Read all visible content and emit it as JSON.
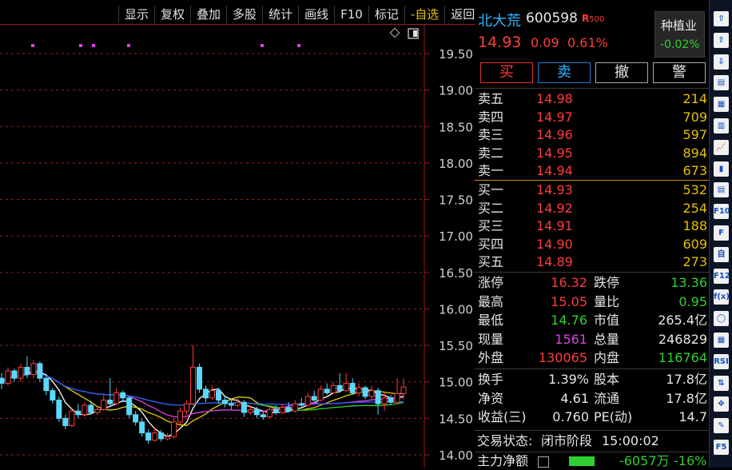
{
  "toolbar": {
    "items": [
      "显示",
      "复权",
      "叠加",
      "多股",
      "统计",
      "画线",
      "F10",
      "标记",
      "-自选",
      "返回"
    ]
  },
  "stock": {
    "name": "北大荒",
    "code": "600598",
    "badge": "R",
    "badge_num": "500",
    "price": "14.93",
    "change": "0.09",
    "change_pct": "0.61%",
    "sector": "种植业",
    "sector_pct": "-0.02%"
  },
  "buttons": {
    "buy": "买",
    "sell": "卖",
    "cancel": "撤",
    "alert": "警"
  },
  "asks": [
    {
      "label": "卖五",
      "price": "14.98",
      "vol": "214"
    },
    {
      "label": "卖四",
      "price": "14.97",
      "vol": "709"
    },
    {
      "label": "卖三",
      "price": "14.96",
      "vol": "597"
    },
    {
      "label": "卖二",
      "price": "14.95",
      "vol": "894"
    },
    {
      "label": "卖一",
      "price": "14.94",
      "vol": "673"
    }
  ],
  "bids": [
    {
      "label": "买一",
      "price": "14.93",
      "vol": "532"
    },
    {
      "label": "买二",
      "price": "14.92",
      "vol": "254"
    },
    {
      "label": "买三",
      "price": "14.91",
      "vol": "188"
    },
    {
      "label": "买四",
      "price": "14.90",
      "vol": "609"
    },
    {
      "label": "买五",
      "price": "14.89",
      "vol": "273"
    }
  ],
  "stats1": [
    {
      "l1": "涨停",
      "v1": "16.32",
      "c1": "#ff3c3c",
      "l2": "跌停",
      "v2": "13.36",
      "c2": "#2fd02f"
    },
    {
      "l1": "最高",
      "v1": "15.05",
      "c1": "#ff3c3c",
      "l2": "量比",
      "v2": "0.95",
      "c2": "#2fd02f"
    },
    {
      "l1": "最低",
      "v1": "14.76",
      "c1": "#2fd02f",
      "l2": "市值",
      "v2": "265.4亿",
      "c2": "#e6e6e6"
    },
    {
      "l1": "现量",
      "v1": "1561",
      "c1": "#e040e0",
      "l2": "总量",
      "v2": "246829",
      "c2": "#e6e6e6"
    },
    {
      "l1": "外盘",
      "v1": "130065",
      "c1": "#ff3c3c",
      "l2": "内盘",
      "v2": "116764",
      "c2": "#2fd02f"
    }
  ],
  "stats2": [
    {
      "l1": "换手",
      "v1": "1.39%",
      "l2": "股本",
      "v2": "17.8亿"
    },
    {
      "l1": "净资",
      "v1": "4.61",
      "l2": "流通",
      "v2": "17.8亿"
    },
    {
      "l1": "收益(三)",
      "v1": "0.760",
      "l2": "PE(动)",
      "v2": "14.7"
    }
  ],
  "trade_status": {
    "label": "交易状态:",
    "status": "闭市阶段",
    "time": "15:00:02"
  },
  "main_flow": {
    "label": "主力净额",
    "value": "-6057万",
    "pct": "-16%"
  },
  "colors": {
    "up": "#ff3c3c",
    "down": "#2fd02f",
    "accent": "#e8c000",
    "grid": "#9e1c1c",
    "ma5": "#ffffff",
    "ma10": "#e8d000",
    "ma20": "#e040e0",
    "ma60": "#2fd02f",
    "ma120": "#3050ff"
  },
  "chart_data": {
    "type": "candlestick",
    "y_ticks": [
      "19.50",
      "19.00",
      "18.50",
      "18.00",
      "17.50",
      "17.00",
      "16.50",
      "16.00",
      "15.50",
      "15.00",
      "14.50",
      "14.00"
    ],
    "ylim": [
      14.0,
      19.6
    ],
    "x_count": 64,
    "candles": [
      [
        15.05,
        14.98,
        15.12,
        14.9
      ],
      [
        14.98,
        15.15,
        15.2,
        14.95
      ],
      [
        15.15,
        15.05,
        15.18,
        15.0
      ],
      [
        15.05,
        15.2,
        15.25,
        15.0
      ],
      [
        15.2,
        15.1,
        15.35,
        15.05
      ],
      [
        15.1,
        15.25,
        15.3,
        15.05
      ],
      [
        15.25,
        15.05,
        15.28,
        15.0
      ],
      [
        15.05,
        14.88,
        15.08,
        14.82
      ],
      [
        14.88,
        14.75,
        14.92,
        14.7
      ],
      [
        14.75,
        14.5,
        14.8,
        14.45
      ],
      [
        14.5,
        14.4,
        14.55,
        14.35
      ],
      [
        14.4,
        14.6,
        14.65,
        14.38
      ],
      [
        14.6,
        14.55,
        14.7,
        14.5
      ],
      [
        14.55,
        14.68,
        14.72,
        14.52
      ],
      [
        14.68,
        14.58,
        14.74,
        14.55
      ],
      [
        14.58,
        14.62,
        14.66,
        14.55
      ],
      [
        14.62,
        14.75,
        14.82,
        14.6
      ],
      [
        14.75,
        14.7,
        15.05,
        14.65
      ],
      [
        14.7,
        14.85,
        14.92,
        14.68
      ],
      [
        14.85,
        14.78,
        14.88,
        14.72
      ],
      [
        14.78,
        14.55,
        14.8,
        14.5
      ],
      [
        14.55,
        14.45,
        14.6,
        14.4
      ],
      [
        14.45,
        14.3,
        14.5,
        14.25
      ],
      [
        14.3,
        14.2,
        14.35,
        14.15
      ],
      [
        14.2,
        14.3,
        14.38,
        14.18
      ],
      [
        14.3,
        14.22,
        14.34,
        14.18
      ],
      [
        14.22,
        14.25,
        14.3,
        14.2
      ],
      [
        14.25,
        14.45,
        14.5,
        14.22
      ],
      [
        14.45,
        14.6,
        14.65,
        14.42
      ],
      [
        14.6,
        14.7,
        14.75,
        14.55
      ],
      [
        14.7,
        15.2,
        15.5,
        14.68
      ],
      [
        15.2,
        14.9,
        15.25,
        14.85
      ],
      [
        14.9,
        14.78,
        14.95,
        14.72
      ],
      [
        14.78,
        14.88,
        14.95,
        14.75
      ],
      [
        14.88,
        14.75,
        14.92,
        14.7
      ],
      [
        14.75,
        14.7,
        14.8,
        14.65
      ],
      [
        14.7,
        14.68,
        14.76,
        14.62
      ],
      [
        14.68,
        14.72,
        14.78,
        14.65
      ],
      [
        14.72,
        14.58,
        14.75,
        14.52
      ],
      [
        14.58,
        14.62,
        14.68,
        14.55
      ],
      [
        14.62,
        14.55,
        14.66,
        14.5
      ],
      [
        14.55,
        14.52,
        14.6,
        14.48
      ],
      [
        14.52,
        14.62,
        14.66,
        14.5
      ],
      [
        14.62,
        14.58,
        14.68,
        14.55
      ],
      [
        14.58,
        14.65,
        14.7,
        14.56
      ],
      [
        14.65,
        14.6,
        14.72,
        14.58
      ],
      [
        14.6,
        14.7,
        14.75,
        14.58
      ],
      [
        14.7,
        14.68,
        14.78,
        14.65
      ],
      [
        14.68,
        14.8,
        14.85,
        14.66
      ],
      [
        14.8,
        14.75,
        14.88,
        14.72
      ],
      [
        14.75,
        14.9,
        14.95,
        14.73
      ],
      [
        14.9,
        14.85,
        14.98,
        14.82
      ],
      [
        14.85,
        14.95,
        15.0,
        14.83
      ],
      [
        14.95,
        14.88,
        15.12,
        14.85
      ],
      [
        14.88,
        14.98,
        15.12,
        14.86
      ],
      [
        14.98,
        14.85,
        15.05,
        14.82
      ],
      [
        14.85,
        14.92,
        14.98,
        14.8
      ],
      [
        14.92,
        14.8,
        14.95,
        14.76
      ],
      [
        14.8,
        14.88,
        14.95,
        14.77
      ],
      [
        14.88,
        14.7,
        14.92,
        14.55
      ],
      [
        14.7,
        14.78,
        14.85,
        14.6
      ],
      [
        14.78,
        14.72,
        14.82,
        14.68
      ],
      [
        14.72,
        14.84,
        15.05,
        14.7
      ],
      [
        14.84,
        14.93,
        15.05,
        14.76
      ]
    ]
  }
}
